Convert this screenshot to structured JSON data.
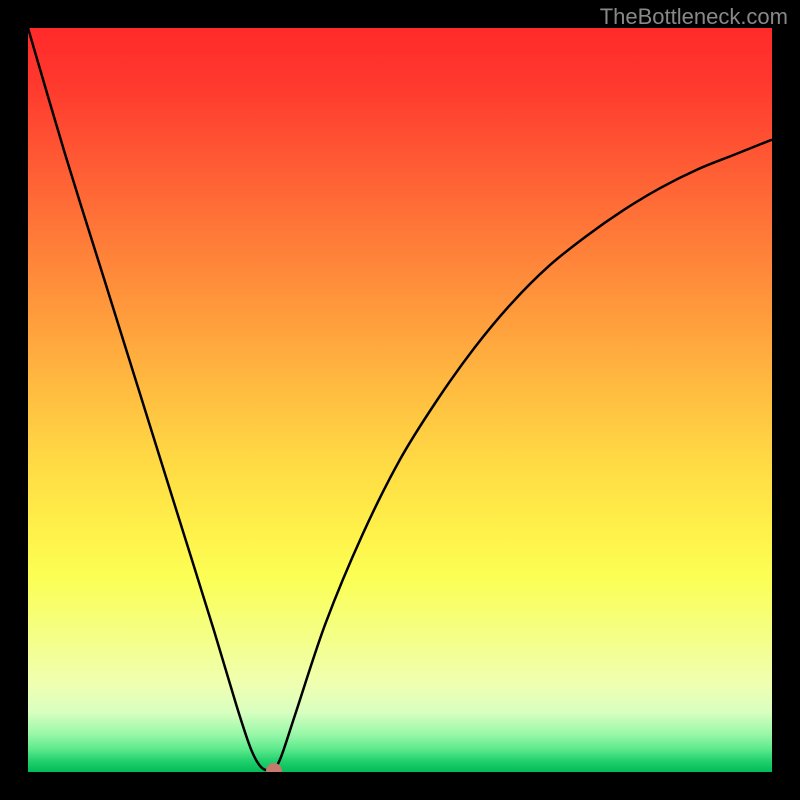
{
  "watermark": "TheBottleneck.com",
  "chart_data": {
    "type": "line",
    "title": "",
    "xlabel": "",
    "ylabel": "",
    "xlim": [
      0,
      100
    ],
    "ylim": [
      0,
      100
    ],
    "curve": {
      "name": "bottleneck-curve",
      "x": [
        0,
        5,
        10,
        15,
        20,
        25,
        28,
        30,
        31.5,
        33,
        34,
        36,
        40,
        45,
        50,
        55,
        60,
        65,
        70,
        75,
        80,
        85,
        90,
        95,
        100
      ],
      "y": [
        100,
        83,
        67,
        51,
        35,
        19,
        9,
        3,
        0.5,
        0.5,
        2,
        8,
        20,
        32,
        42,
        50,
        57,
        63,
        68,
        72,
        75.5,
        78.5,
        81,
        83,
        85
      ]
    },
    "marker": {
      "x": 33,
      "y": 0.2
    },
    "background_gradient": {
      "direction": "vertical",
      "stops": [
        {
          "pos": 0.0,
          "color": "#ff2a2a"
        },
        {
          "pos": 0.5,
          "color": "#ffd944"
        },
        {
          "pos": 0.82,
          "color": "#f4ff88"
        },
        {
          "pos": 1.0,
          "color": "#00bd58"
        }
      ]
    }
  }
}
